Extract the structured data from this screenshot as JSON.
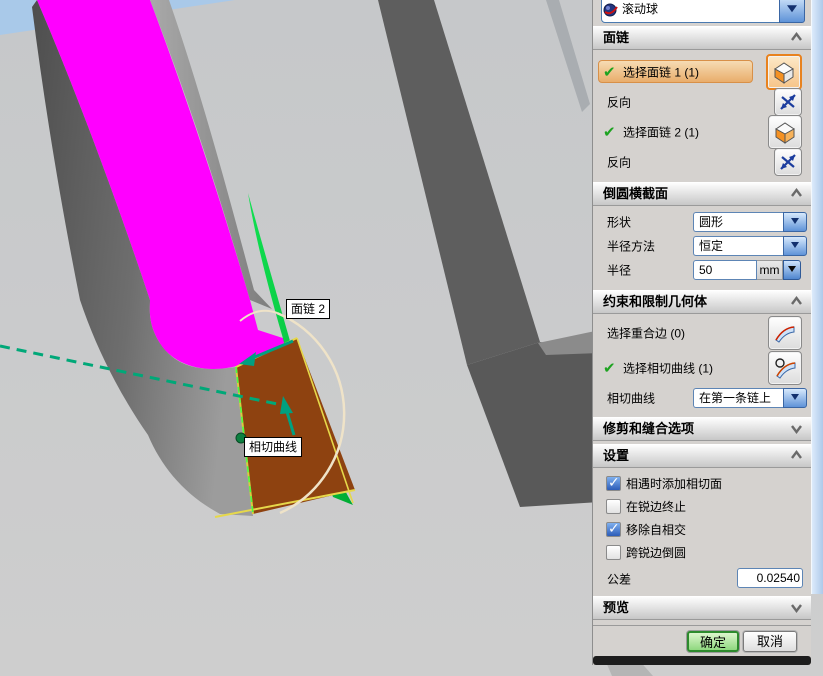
{
  "viewport": {
    "labels": {
      "face_chain_2": "面链 2",
      "tangent_curve": "相切曲线"
    },
    "colors": {
      "face_chain_1_highlight": "#FF00FF",
      "face_chain_2_highlight": "#00CC44",
      "selected_face": "#8E4210",
      "direction_arrow": "#00A080",
      "preview_arc": "#EFE3C8"
    }
  },
  "dialog": {
    "shape_method": {
      "value": "滚动球",
      "icon": "rolling-ball-icon"
    },
    "groups": {
      "face_chain": {
        "title": "面链",
        "select1": {
          "label": "选择面链 1",
          "count": "(1)"
        },
        "reverse1": {
          "label": "反向"
        },
        "select2": {
          "label": "选择面链 2",
          "count": "(1)"
        },
        "reverse2": {
          "label": "反向"
        }
      },
      "cross_section": {
        "title": "倒圆横截面",
        "shape": {
          "label": "形状",
          "value": "圆形"
        },
        "radius_method": {
          "label": "半径方法",
          "value": "恒定"
        },
        "radius": {
          "label": "半径",
          "value": "50",
          "unit": "mm"
        }
      },
      "constraints": {
        "title": "约束和限制几何体",
        "coincident": {
          "label": "选择重合边",
          "count": "(0)"
        },
        "tangent": {
          "label": "选择相切曲线",
          "count": "(1)"
        },
        "tangent_curve": {
          "label": "相切曲线",
          "value": "在第一条链上"
        }
      },
      "trim": {
        "title": "修剪和缝合选项"
      },
      "settings": {
        "title": "设置",
        "checkboxes": [
          {
            "label": "相遇时添加相切面",
            "checked": true
          },
          {
            "label": "在锐边终止",
            "checked": false
          },
          {
            "label": "移除自相交",
            "checked": true
          },
          {
            "label": "跨锐边倒圆",
            "checked": false
          }
        ],
        "tolerance": {
          "label": "公差",
          "value": "0.02540"
        }
      },
      "preview": {
        "title": "预览"
      }
    },
    "buttons": {
      "ok": "确定",
      "cancel": "取消"
    }
  }
}
